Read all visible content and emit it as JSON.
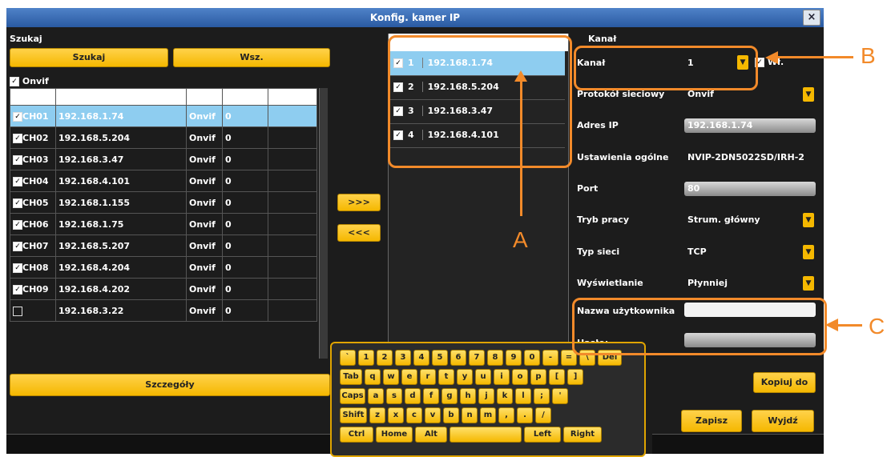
{
  "window": {
    "title": "Konfig. kamer IP",
    "close_glyph": "×"
  },
  "search": {
    "section_label": "Szukaj",
    "search_button": "Szukaj",
    "all_button": "Wsz.",
    "onvif_checkbox_label": "Onvif",
    "details_button": "Szczegóły",
    "rows": [
      {
        "ch": "CH01",
        "ip": "192.168.1.74",
        "proto": "Onvif",
        "num": "0",
        "checked": true,
        "selected": true
      },
      {
        "ch": "CH02",
        "ip": "192.168.5.204",
        "proto": "Onvif",
        "num": "0",
        "checked": true,
        "selected": false
      },
      {
        "ch": "CH03",
        "ip": "192.168.3.47",
        "proto": "Onvif",
        "num": "0",
        "checked": true,
        "selected": false
      },
      {
        "ch": "CH04",
        "ip": "192.168.4.101",
        "proto": "Onvif",
        "num": "0",
        "checked": true,
        "selected": false
      },
      {
        "ch": "CH05",
        "ip": "192.168.1.155",
        "proto": "Onvif",
        "num": "0",
        "checked": true,
        "selected": false
      },
      {
        "ch": "CH06",
        "ip": "192.168.1.75",
        "proto": "Onvif",
        "num": "0",
        "checked": true,
        "selected": false
      },
      {
        "ch": "CH07",
        "ip": "192.168.5.207",
        "proto": "Onvif",
        "num": "0",
        "checked": true,
        "selected": false
      },
      {
        "ch": "CH08",
        "ip": "192.168.4.204",
        "proto": "Onvif",
        "num": "0",
        "checked": true,
        "selected": false
      },
      {
        "ch": "CH09",
        "ip": "192.168.4.202",
        "proto": "Onvif",
        "num": "0",
        "checked": true,
        "selected": false
      },
      {
        "ch": "",
        "ip": "192.168.3.22",
        "proto": "Onvif",
        "num": "0",
        "checked": false,
        "selected": false
      }
    ]
  },
  "transfer": {
    "add_button": ">>>",
    "remove_button": "<<<"
  },
  "added": {
    "rows": [
      {
        "n": "1",
        "ip": "192.168.1.74",
        "selected": true
      },
      {
        "n": "2",
        "ip": "192.168.5.204",
        "selected": false
      },
      {
        "n": "3",
        "ip": "192.168.3.47",
        "selected": false
      },
      {
        "n": "4",
        "ip": "192.168.4.101",
        "selected": false
      }
    ]
  },
  "channel": {
    "section_label": "Kanał",
    "channel_label": "Kanał",
    "channel_value": "1",
    "enable_label": "Wł.",
    "protocol_label": "Protokół sieciowy",
    "protocol_value": "Onvif",
    "ip_label": "Adres IP",
    "ip_value": "192.168.1.74",
    "general_label": "Ustawienia ogólne",
    "general_value": "NVIP-2DN5022SD/IRH-2",
    "port_label": "Port",
    "port_value": "80",
    "mode_label": "Tryb pracy",
    "mode_value": "Strum. główny",
    "nettype_label": "Typ sieci",
    "nettype_value": "TCP",
    "display_label": "Wyświetlanie",
    "display_value": "Płynniej",
    "user_label": "Nazwa użytkownika",
    "user_value": "",
    "password_label": "Hasło:",
    "password_value": "",
    "copy_button": "Kopiuj do",
    "save_button": "Zapisz",
    "exit_button": "Wyjdź"
  },
  "keyboard": {
    "row1": [
      "`",
      "1",
      "2",
      "3",
      "4",
      "5",
      "6",
      "7",
      "8",
      "9",
      "0",
      "-",
      "=",
      "\\",
      "Del"
    ],
    "row2": [
      "Tab",
      "q",
      "w",
      "e",
      "r",
      "t",
      "y",
      "u",
      "i",
      "o",
      "p",
      "[",
      "]"
    ],
    "row3": [
      "Caps",
      "a",
      "s",
      "d",
      "f",
      "g",
      "h",
      "j",
      "k",
      "l",
      ";",
      "'"
    ],
    "row4": [
      "Shift",
      "z",
      "x",
      "c",
      "v",
      "b",
      "n",
      "m",
      ",",
      ".",
      "/"
    ],
    "row5": [
      "Ctrl",
      "Home",
      "Alt",
      "",
      "Left",
      "Right"
    ]
  },
  "annotations": {
    "a": "A",
    "b": "B",
    "c": "C"
  },
  "colors": {
    "accent_yellow": "#f5b800",
    "selected_row": "#8ecdf0",
    "callout_orange": "#f28a2a",
    "titlebar": "#2a5aa2"
  }
}
